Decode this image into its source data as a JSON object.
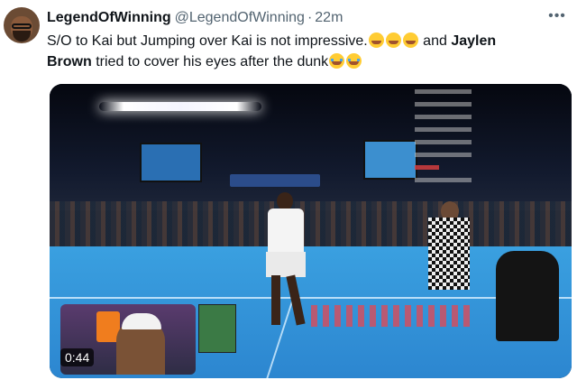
{
  "tweet": {
    "author_name": "LegendOfWinning",
    "author_handle": "@LegendOfWinning",
    "separator": "·",
    "time": "22m",
    "more_label": "•••",
    "text": {
      "line1_part1": "S/O to Kai but Jumping over Kai is not impressive.",
      "line1_part2": " and ",
      "bold_name_1": "Jaylen",
      "bold_name_2": "Brown",
      "line2_part": " tried to cover his eyes after the dunk"
    }
  },
  "media": {
    "video_timestamp": "0:44"
  },
  "colors": {
    "accent_text": "#0f1419",
    "muted_text": "#536471",
    "court_blue": "#3aa0e0"
  }
}
